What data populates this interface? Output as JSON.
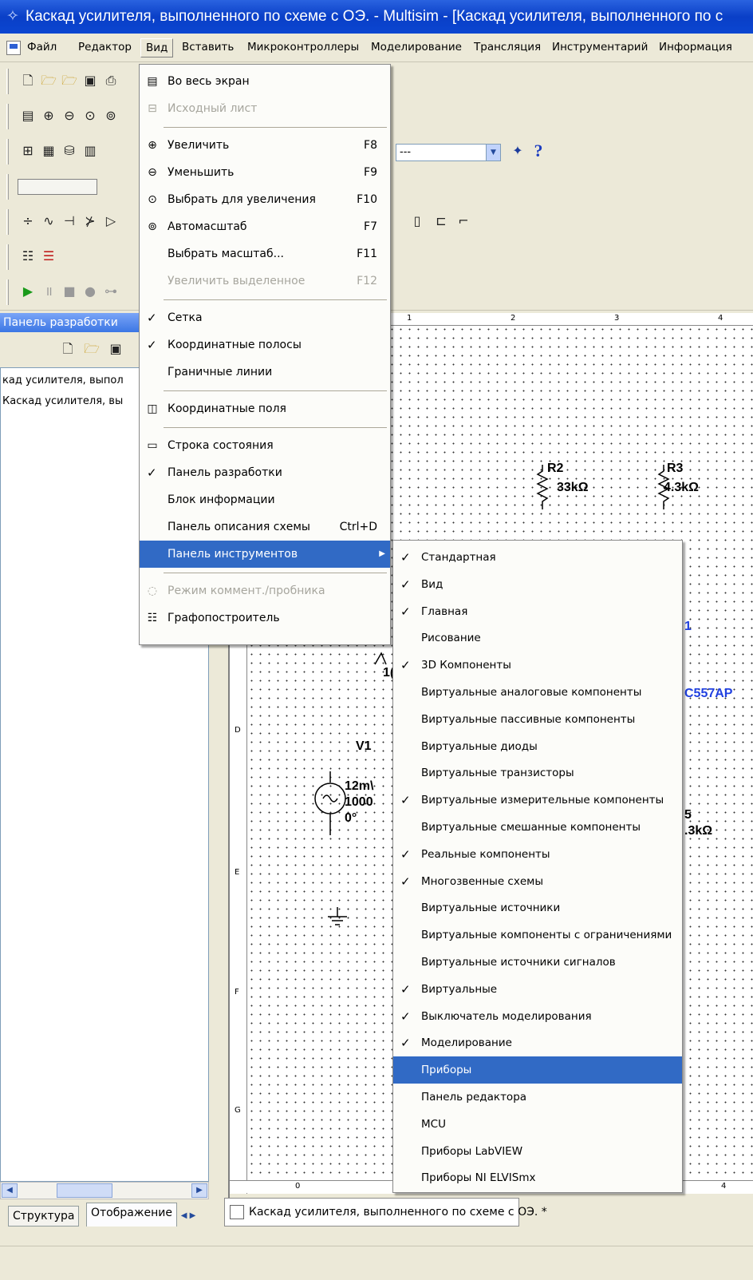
{
  "window": {
    "title": "Каскад усилителя, выполненного по схеме с ОЭ. - Multisim - [Каскад усилителя, выполненного по с"
  },
  "menubar": [
    {
      "label": "Файл"
    },
    {
      "label": "Редактор"
    },
    {
      "label": "Вид"
    },
    {
      "label": "Вставить"
    },
    {
      "label": "Микроконтроллеры"
    },
    {
      "label": "Моделирование"
    },
    {
      "label": "Трансляция"
    },
    {
      "label": "Инструментарий"
    },
    {
      "label": "Информация"
    }
  ],
  "toolbar": {
    "combo_value": "---",
    "help_glyph": "?"
  },
  "left_panel": {
    "title": "Панель разработки",
    "tree": [
      "кад усилителя, выпол",
      "Каскад усилителя, вы"
    ],
    "tabs": [
      "Структура",
      "Отображение"
    ]
  },
  "view_menu": [
    {
      "label": "Во весь экран",
      "shortcut": "",
      "icon": "fullscreen-icon",
      "state": "normal"
    },
    {
      "label": "Исходный лист",
      "shortcut": "",
      "icon": "parent-sheet-icon",
      "state": "disabled"
    },
    {
      "label": "Увеличить",
      "shortcut": "F8",
      "icon": "zoom-in-icon",
      "state": "normal"
    },
    {
      "label": "Уменьшить",
      "shortcut": "F9",
      "icon": "zoom-out-icon",
      "state": "normal"
    },
    {
      "label": "Выбрать для увеличения",
      "shortcut": "F10",
      "icon": "zoom-area-icon",
      "state": "normal"
    },
    {
      "label": "Автомасштаб",
      "shortcut": "F7",
      "icon": "zoom-fit-icon",
      "state": "normal"
    },
    {
      "label": "Выбрать масштаб...",
      "shortcut": "F11",
      "icon": "",
      "state": "normal"
    },
    {
      "label": "Увеличить выделенное",
      "shortcut": "F12",
      "icon": "",
      "state": "disabled"
    },
    {
      "label": "Сетка",
      "shortcut": "",
      "icon": "check",
      "state": "checked"
    },
    {
      "label": "Координатные полосы",
      "shortcut": "",
      "icon": "check",
      "state": "checked"
    },
    {
      "label": "Граничные линии",
      "shortcut": "",
      "icon": "",
      "state": "normal"
    },
    {
      "label": "Координатные поля",
      "shortcut": "",
      "icon": "title-block-icon",
      "state": "normal"
    },
    {
      "label": "Строка состояния",
      "shortcut": "",
      "icon": "status-bar-icon",
      "state": "normal"
    },
    {
      "label": "Панель разработки",
      "shortcut": "",
      "icon": "check",
      "state": "checked"
    },
    {
      "label": "Блок информации",
      "shortcut": "",
      "icon": "",
      "state": "normal"
    },
    {
      "label": "Панель описания схемы",
      "shortcut": "Ctrl+D",
      "icon": "",
      "state": "normal"
    },
    {
      "label": "Панель инструментов",
      "shortcut": "",
      "icon": "",
      "state": "selected"
    },
    {
      "label": "Режим коммент./пробника",
      "shortcut": "",
      "icon": "comment-icon",
      "state": "disabled"
    },
    {
      "label": "Графопостроитель",
      "shortcut": "",
      "icon": "grapher-icon",
      "state": "normal"
    }
  ],
  "toolbars_submenu": [
    {
      "label": "Стандартная",
      "checked": true
    },
    {
      "label": "Вид",
      "checked": true
    },
    {
      "label": "Главная",
      "checked": true
    },
    {
      "label": "Рисование",
      "checked": false
    },
    {
      "label": "3D Компоненты",
      "checked": true
    },
    {
      "label": "Виртуальные аналоговые компоненты",
      "checked": false
    },
    {
      "label": "Виртуальные пассивные компоненты",
      "checked": false
    },
    {
      "label": "Виртуальные диоды",
      "checked": false
    },
    {
      "label": "Виртуальные транзисторы",
      "checked": false
    },
    {
      "label": "Виртуальные измерительные компоненты",
      "checked": true
    },
    {
      "label": "Виртуальные смешанные компоненты",
      "checked": false
    },
    {
      "label": "Реальные компоненты",
      "checked": true
    },
    {
      "label": "Многозвенные схемы",
      "checked": true
    },
    {
      "label": "Виртуальные источники",
      "checked": false
    },
    {
      "label": "Виртуальные компоненты с ограничениями",
      "checked": false
    },
    {
      "label": "Виртуальные источники сигналов",
      "checked": false
    },
    {
      "label": "Виртуальные",
      "checked": true
    },
    {
      "label": "Выключатель моделирования",
      "checked": true
    },
    {
      "label": "Моделирование",
      "checked": true
    },
    {
      "label": "Приборы",
      "checked": false,
      "highlighted": true
    },
    {
      "label": "Панель редактора",
      "checked": false
    },
    {
      "label": "MCU",
      "checked": false
    },
    {
      "label": "Приборы LabVIEW",
      "checked": false
    },
    {
      "label": "Приборы NI ELVISmx",
      "checked": false
    }
  ],
  "schematic": {
    "r2_name": "R2",
    "r2_value": "33kΩ",
    "r3_name": "R3",
    "r3_value": "4.3kΩ",
    "v1_name": "V1",
    "v1_amp": "12m\\",
    "v1_freq": "1000",
    "v1_phase": "0°",
    "transistor": "C557AP",
    "node_label": "1",
    "partial_1": "1(",
    "r5_name": "5",
    "r5_value": ".3kΩ",
    "ruler_top": [
      "1",
      "2",
      "3",
      "4"
    ],
    "ruler_left": [
      "D",
      "E",
      "F",
      "G"
    ],
    "ruler_bottom": [
      "0",
      "4"
    ]
  },
  "document_tab": "Каскад усилителя, выполненного по схеме с ОЭ. *",
  "colors": {
    "menu_highlight": "#316ac5",
    "titlebar": "#0a3fc7",
    "component_blue": "#2040e0"
  }
}
